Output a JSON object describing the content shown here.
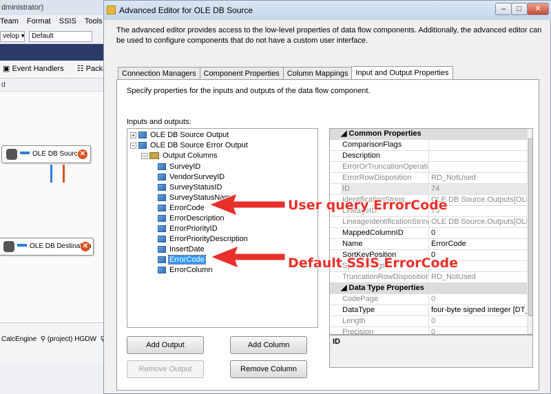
{
  "background": {
    "title": "dministrator)",
    "menu": [
      "Team",
      "Format",
      "SSIS",
      "Tools"
    ],
    "toolbar": {
      "combo1": "velop",
      "combo2": "Default"
    },
    "tabs": [
      "Event Handlers",
      "Packag"
    ],
    "d_label": "d",
    "components": {
      "source": "OLE DB Source",
      "destination": "OLE DB Destination"
    },
    "connections": [
      "CalcEngine",
      "(project) HGDW",
      "(p"
    ]
  },
  "dialog": {
    "title": "Advanced Editor for OLE DB Source",
    "window_buttons": [
      "–",
      "□",
      "✕"
    ],
    "description": "The advanced editor provides access to the low-level properties of data flow components. Additionally, the advanced editor can be used to configure components that do not have a custom user interface.",
    "tabs": [
      "Connection Managers",
      "Component Properties",
      "Column Mappings",
      "Input and Output Properties"
    ],
    "active_tab": "Input and Output Properties",
    "panel_description": "Specify properties for the inputs and outputs of the data flow component.",
    "io_label": "Inputs and outputs:",
    "tree": {
      "output": "OLE DB Source Output",
      "error_output": "OLE DB Source Error Output",
      "output_columns": "Output Columns",
      "columns": [
        "SurveyID",
        "VendorSurveyID",
        "SurveyStatusID",
        "SurveyStatusName",
        "ErrorCode",
        "ErrorDescription",
        "ErrorPriorityID",
        "ErrorPriorityDescription",
        "InsertDate",
        "ErrorCode",
        "ErrorColumn"
      ],
      "selected_index": 9
    },
    "properties": {
      "common_header": "Common Properties",
      "common": [
        {
          "k": "ComparisonFlags",
          "v": ""
        },
        {
          "k": "Description",
          "v": ""
        },
        {
          "k": "ErrorOrTruncationOperation",
          "v": ""
        },
        {
          "k": "ErrorRowDisposition",
          "v": "RD_NotUsed"
        },
        {
          "k": "ID",
          "v": "74"
        },
        {
          "k": "IdentificationString",
          "v": "OLE DB Source.Outputs[OLE DB"
        },
        {
          "k": "LineageID",
          "v": "75"
        },
        {
          "k": "LineageIdentificationString",
          "v": "OLE DB Source.Outputs[OLE DB"
        },
        {
          "k": "MappedColumnID",
          "v": "0"
        },
        {
          "k": "Name",
          "v": "ErrorCode"
        },
        {
          "k": "SortKeyPosition",
          "v": "0"
        },
        {
          "k": "SpecialFlags",
          "v": "1"
        },
        {
          "k": "TruncationRowDisposition",
          "v": "RD_NotUsed"
        }
      ],
      "datatype_header": "Data Type Properties",
      "datatype": [
        {
          "k": "CodePage",
          "v": "0"
        },
        {
          "k": "DataType",
          "v": "four-byte signed integer [DT_I4]"
        },
        {
          "k": "Length",
          "v": "0"
        },
        {
          "k": "Precision",
          "v": "0"
        }
      ]
    },
    "id_box": "ID",
    "buttons": {
      "add_output": "Add Output",
      "add_column": "Add Column",
      "remove_output": "Remove Output",
      "remove_column": "Remove Column"
    }
  },
  "annotations": {
    "user_query": "User query ErrorCode",
    "default_ssis": "Default SSIS ErrorCode",
    "color": "#e8302a"
  }
}
